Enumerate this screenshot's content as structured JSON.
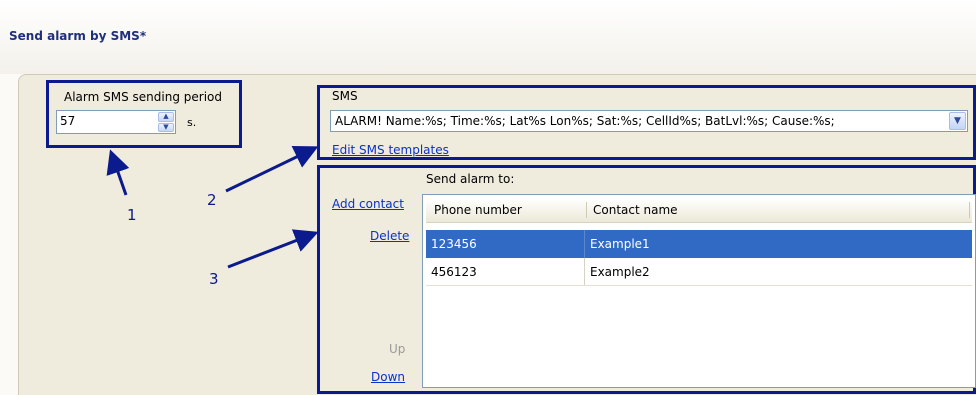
{
  "page": {
    "title": "Send alarm by SMS*"
  },
  "period": {
    "label": "Alarm SMS sending period",
    "value": "57",
    "unit": "s."
  },
  "sms": {
    "label": "SMS",
    "selected_template": "ALARM! Name:%s; Time:%s; Lat%s Lon%s; Sat:%s; CellId%s; BatLvl:%s; Cause:%s;",
    "edit_link": "Edit SMS templates"
  },
  "contacts": {
    "label": "Send alarm to:",
    "add_label": "Add contact",
    "delete_label": "Delete",
    "up_label": "Up",
    "down_label": "Down",
    "columns": [
      "Phone number",
      "Contact name"
    ],
    "rows": [
      {
        "phone": "123456",
        "name": "Example1",
        "selected": true
      },
      {
        "phone": "456123",
        "name": "Example2",
        "selected": false
      }
    ]
  },
  "annotations": {
    "n1": "1",
    "n2": "2",
    "n3": "3"
  },
  "colors": {
    "annotation": "#0b1a8c",
    "selection": "#316ac5",
    "link": "#0a32c8"
  }
}
